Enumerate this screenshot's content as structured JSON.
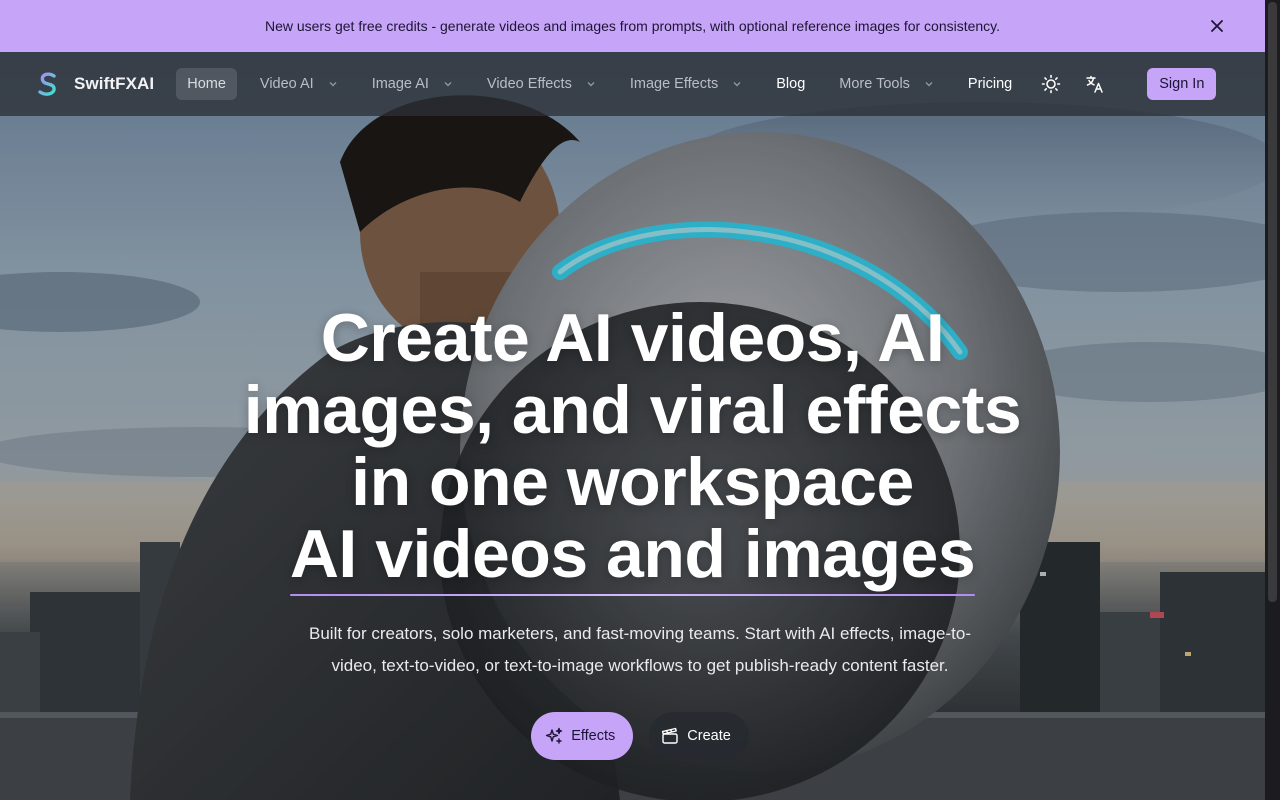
{
  "announcement": {
    "text": "New users get free credits - generate videos and images from prompts, with optional reference images for consistency."
  },
  "brand": {
    "name": "SwiftFXAI",
    "accent": "#c6a4f7"
  },
  "nav": {
    "items": [
      {
        "label": "Home",
        "active": true
      },
      {
        "label": "Video AI",
        "dropdown": true
      },
      {
        "label": "Image AI",
        "dropdown": true
      },
      {
        "label": "Video Effects",
        "dropdown": true
      },
      {
        "label": "Image Effects",
        "dropdown": true
      },
      {
        "label": "Blog"
      },
      {
        "label": "More Tools",
        "dropdown": true
      },
      {
        "label": "Pricing"
      }
    ],
    "theme_icon": "sun-icon",
    "language_icon": "translate-icon",
    "signin_label": "Sign In"
  },
  "hero": {
    "headline_lines": [
      "Create AI videos, AI",
      "images, and viral effects",
      "in one workspace"
    ],
    "headline_accent": "AI videos and images",
    "subtext": "Built for creators, solo marketers, and fast-moving teams. Start with AI effects, image-to-video, text-to-video, or text-to-image workflows to get publish-ready content faster.",
    "cta_primary": {
      "label": "Effects",
      "icon": "sparkles-icon"
    },
    "cta_secondary": {
      "label": "Create",
      "icon": "clapperboard-icon"
    }
  }
}
